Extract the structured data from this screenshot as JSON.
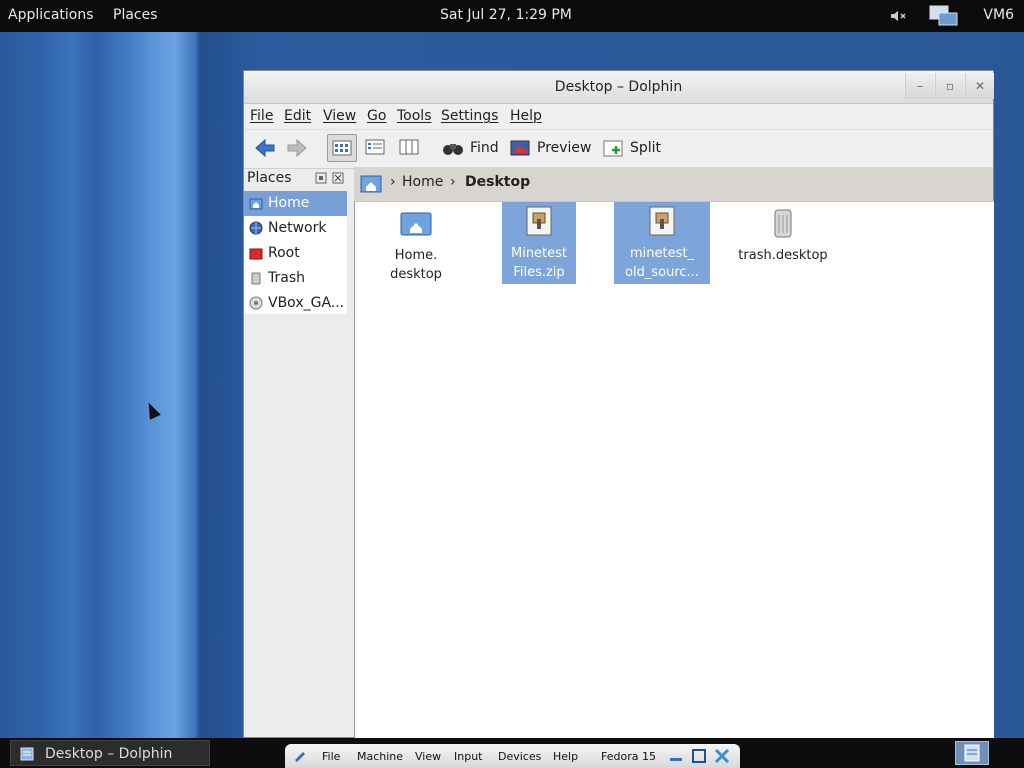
{
  "top_panel": {
    "applications": "Applications",
    "places": "Places",
    "clock": "Sat Jul 27,  1:29 PM",
    "vm_name": "VM6"
  },
  "window": {
    "title": "Desktop – Dolphin",
    "menus": [
      "File",
      "Edit",
      "View",
      "Go",
      "Tools",
      "Settings",
      "Help"
    ],
    "toolbar": {
      "find": "Find",
      "preview": "Preview",
      "split": "Split"
    },
    "places_panel": {
      "title": "Places",
      "items": [
        {
          "label": "Home",
          "icon": "home-icon",
          "selected": true
        },
        {
          "label": "Network",
          "icon": "network-icon",
          "selected": false
        },
        {
          "label": "Root",
          "icon": "folder-red-icon",
          "selected": false
        },
        {
          "label": "Trash",
          "icon": "trash-icon",
          "selected": false
        },
        {
          "label": "VBox_GA...",
          "icon": "disc-icon",
          "selected": false
        }
      ]
    },
    "breadcrumb": {
      "home": "Home",
      "current": "Desktop",
      "separator": "›"
    },
    "files": [
      {
        "line1": "Home.",
        "line2": "desktop",
        "icon": "home-folder-icon",
        "selected": false
      },
      {
        "line1": "Minetest",
        "line2": "Files.zip",
        "icon": "archive-icon",
        "selected": true
      },
      {
        "line1": "minetest_",
        "line2": "old_sourc...",
        "icon": "archive-icon",
        "selected": true
      },
      {
        "line1": "trash.desktop",
        "line2": "",
        "icon": "trash-icon",
        "selected": false
      }
    ]
  },
  "taskbar": {
    "task_label": "Desktop – Dolphin"
  },
  "vbox_bar": {
    "file": "File",
    "machine": "Machine",
    "view": "View",
    "input": "Input",
    "devices": "Devices",
    "help": "Help",
    "vm": "Fedora 15"
  },
  "colors": {
    "selection": "#7da5da",
    "desktop": "#2c5c9f"
  }
}
